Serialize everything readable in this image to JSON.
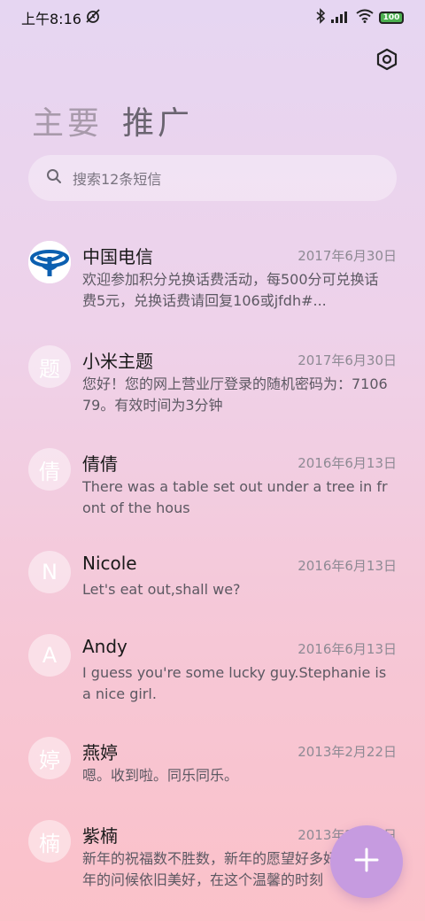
{
  "status_bar": {
    "time": "上午8:16",
    "battery": "100"
  },
  "tabs": {
    "main": "主要",
    "promo": "推广"
  },
  "search": {
    "placeholder": "搜索12条短信"
  },
  "messages": [
    {
      "avatar": "",
      "name": "中国电信",
      "date": "2017年6月30日",
      "preview": "欢迎参加积分兑换话费活动，每500分可兑换话费5元，兑换话费请回复106或jfdh#..."
    },
    {
      "avatar": "题",
      "name": "小米主题",
      "date": "2017年6月30日",
      "preview": "您好！您的网上营业厅登录的随机密码为：710679。有效时间为3分钟"
    },
    {
      "avatar": "倩",
      "name": "倩倩",
      "date": "2016年6月13日",
      "preview": "There was a table set out under a tree in front of the hous"
    },
    {
      "avatar": "N",
      "name": "Nicole",
      "date": "2016年6月13日",
      "preview": "Let's eat out,shall we?"
    },
    {
      "avatar": "A",
      "name": "Andy",
      "date": "2016年6月13日",
      "preview": "I guess you're some lucky guy.Stephanie is a nice girl."
    },
    {
      "avatar": "婷",
      "name": "燕婷",
      "date": "2013年2月22日",
      "preview": "嗯。收到啦。同乐同乐。"
    },
    {
      "avatar": "楠",
      "name": "紫楠",
      "date": "2013年2月22日",
      "preview": "新年的祝福数不胜数，新年的愿望好多好多，新年的问候依旧美好，在这个温馨的时刻"
    }
  ]
}
